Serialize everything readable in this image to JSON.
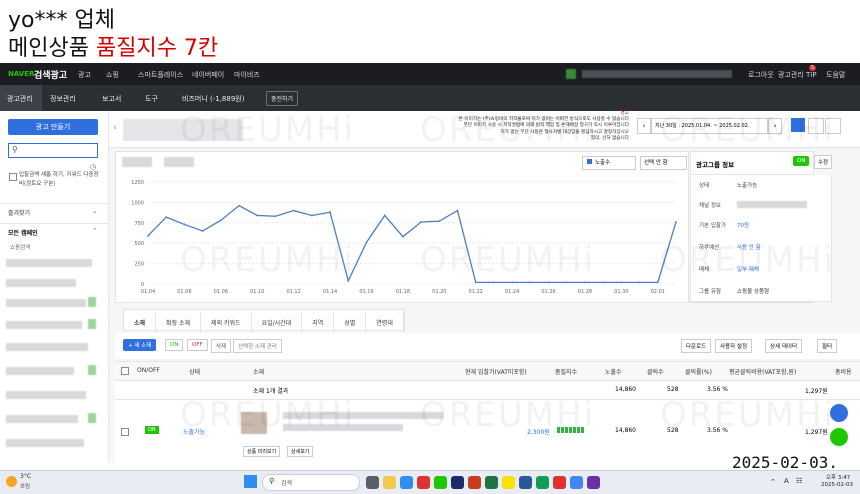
{
  "caption": {
    "line1": "yo*** 업체",
    "line2_black": "메인상품 ",
    "line2_red": "품질지수 7칸"
  },
  "topbar": {
    "brand": "NAVER",
    "product": "검색광고",
    "menu": [
      "광고",
      "쇼핑",
      "스마트플레이스",
      "네이버페이",
      "마이비즈"
    ],
    "right": [
      "로그아웃",
      "광고관리 TIP",
      "도움말"
    ],
    "tip_badge": "5"
  },
  "navbar": {
    "items": [
      "광고관리",
      "정보관리",
      "보고서",
      "도구",
      "비즈머니 (-1,889원)"
    ],
    "charge_button": "충전하기"
  },
  "sidebar": {
    "create_button": "광고 만들기",
    "search_placeholder": "",
    "checkbox_label": "입찰금액 새롭 하기, 키워드 다중정비(검토요 구분)",
    "favorites": "즐겨찾기",
    "all_campaigns": "모든 캠페인",
    "sub_item": "쇼핑검색"
  },
  "notice": {
    "label": "경고",
    "lines": [
      "본 이미지는 (주)쇼핑비의 저작물로써 허가 없이는 어떠한 방식으로도 사용할 수 없습니다",
      "무단 이미지 사용 시 저작권법에 의해 법적 책임 및 손해배상 청구가 즉시 이루어집니다",
      "허가 없는 무단 사용은 형사처벌 대상임을 명심하시고 결정하십시오",
      "협의, 선처 없습니다"
    ]
  },
  "date_range": {
    "label": "지난 30일 : 2025.01.04. ~ 2025.02.02."
  },
  "chart_controls": {
    "metric_select": "노출수",
    "compare_select": "선택 안 함"
  },
  "chart_data": {
    "type": "line",
    "x": [
      "01.04",
      "01.05",
      "01.06",
      "01.07",
      "01.08",
      "01.09",
      "01.10",
      "01.11",
      "01.12",
      "01.13",
      "01.14",
      "01.15",
      "01.16",
      "01.17",
      "01.18",
      "01.19",
      "01.20",
      "01.21",
      "01.22",
      "01.23",
      "01.24",
      "01.25",
      "01.26",
      "01.27",
      "01.28",
      "01.29",
      "01.30",
      "01.31",
      "02.01",
      "02.02"
    ],
    "xticks": [
      "01.04",
      "01.06",
      "01.08",
      "01.10",
      "01.12",
      "01.14",
      "01.16",
      "01.18",
      "01.20",
      "01.22",
      "01.24",
      "01.26",
      "01.28",
      "01.30",
      "02.01"
    ],
    "series": [
      {
        "values": [
          590,
          820,
          730,
          650,
          780,
          960,
          840,
          830,
          900,
          840,
          880,
          40,
          510,
          840,
          580,
          760,
          770,
          900,
          20,
          20,
          20,
          20,
          20,
          20,
          20,
          20,
          20,
          20,
          20,
          760
        ]
      }
    ],
    "yticks": [
      0,
      250,
      500,
      750,
      1000,
      1250
    ],
    "ylim": [
      0,
      1250
    ],
    "grid": true,
    "color": "#4a7fc4"
  },
  "ad_group": {
    "title": "광고그룹 정보",
    "toggle": "ON",
    "edit": "수정",
    "rows": [
      {
        "label": "상태",
        "value": "노출가능"
      },
      {
        "label": "채널 정보",
        "value": ""
      },
      {
        "label": "기본 입찰가",
        "value": "70원"
      },
      {
        "label": "하루예산",
        "value": "사용 안 함"
      },
      {
        "label": "매체",
        "value": "일부 매체"
      },
      {
        "label": "그룹 유형",
        "value": "쇼핑몰 상품형"
      }
    ]
  },
  "tabs": [
    "소재",
    "확장 소재",
    "제외 키워드",
    "요일/시간대",
    "지역",
    "성별",
    "연령대"
  ],
  "toolbar": {
    "new_button": "+ 새 소재",
    "on": "ON",
    "off": "OFF",
    "delete": "삭제",
    "select_more": "선택한 소재 관리",
    "download": "다운로드",
    "columns": "사용자 설정",
    "detail_data": "상세 데이터",
    "filter": "필터"
  },
  "table": {
    "headers": [
      "ON/OFF",
      "상태",
      "소재",
      "현재 입찰가(VAT미포함)",
      "품질지수",
      "노출수",
      "클릭수",
      "클릭률(%)",
      "평균클릭비용(VAT포함,원)",
      "총비용"
    ],
    "summary_label": "소재 1개 결과",
    "summary": {
      "impressions": "14,860",
      "clicks": "528",
      "ctr": "3.56 %",
      "cpc": "1,297원"
    },
    "row": {
      "toggle": "ON",
      "status": "노출가능",
      "bid": "2,300원",
      "impressions": "14,860",
      "clicks": "528",
      "ctr": "3.56 %",
      "cpc": "1,297원",
      "buttons": [
        "상품 미리보기",
        "상세보기"
      ]
    }
  },
  "timestamp": "2025-02-03.",
  "watermark": "OREUMHi",
  "taskbar": {
    "weather_temp": "3°C",
    "weather_desc": "흐림",
    "search": "검색",
    "lang": "A",
    "time": "오후 3:47",
    "date": "2025-02-03"
  }
}
